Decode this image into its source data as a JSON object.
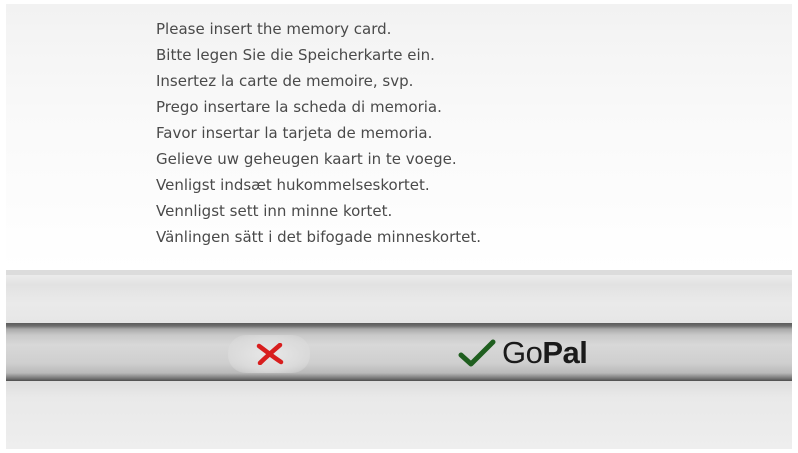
{
  "message": {
    "lines": [
      "Please insert the memory card.",
      "Bitte legen Sie die Speicherkarte ein.",
      "Insertez la carte de memoire, svp.",
      "Prego insertare la scheda di memoria.",
      "Favor insertar la tarjeta de memoria.",
      "Gelieve uw geheugen kaart in te voege.",
      "Venligst indsæt hukommelseskortet.",
      "Vennligst sett inn minne kortet.",
      "Vänlingen sätt i det bifogade minneskortet."
    ]
  },
  "toolbar": {
    "cancel_icon": "close-icon",
    "confirm_icon": "checkmark-icon",
    "logo": {
      "part1": "Go",
      "part2": "Pal"
    }
  },
  "colors": {
    "cancel_red": "#d81e1e",
    "check_green": "#1f5e1f",
    "text_gray": "#4a4a4a"
  }
}
